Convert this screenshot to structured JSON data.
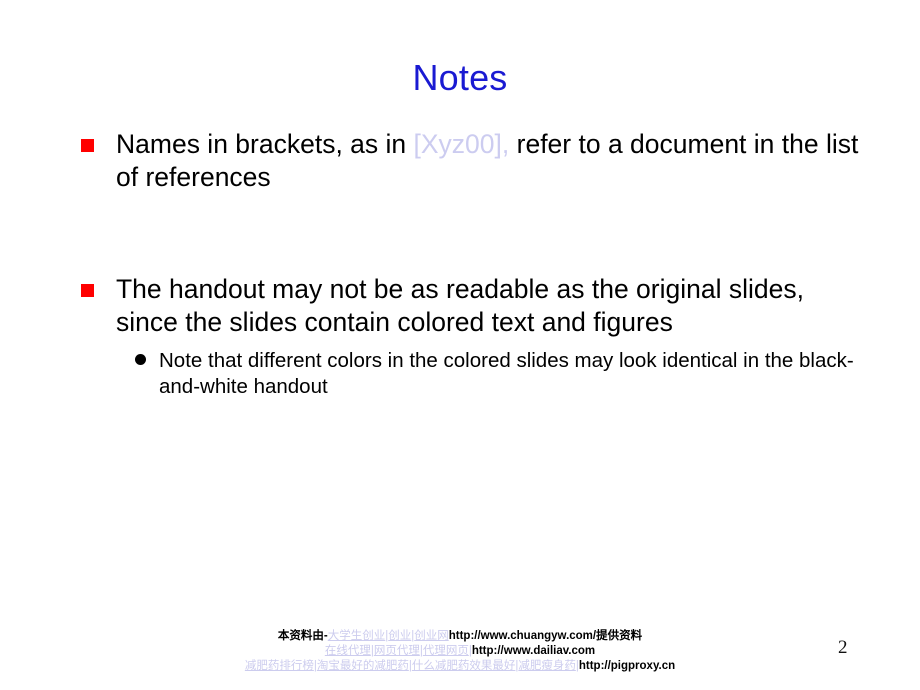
{
  "slide": {
    "title": "Notes",
    "title_color": "#1a1ad2",
    "bullet_marker_color": "#ff0000",
    "highlight_color": "#ccccf0",
    "page_number": "2"
  },
  "bullets": [
    {
      "marker": "red-square",
      "text_before": "Names in brackets, as in ",
      "highlight": "[Xyz00],",
      "text_after": " refer to a document in the list of references"
    },
    {
      "marker": "red-square",
      "text_before": "The handout may not be as readable as the original slides, since the slides contain colored text and figures",
      "highlight": "",
      "text_after": ""
    }
  ],
  "sub_bullets": [
    {
      "marker": "black-dot",
      "text": "Note that different colors in the colored slides may look identical in the black-and-white handout"
    }
  ],
  "footer": {
    "line1": {
      "prefix": "本资料由-",
      "links": [
        "大学生创业",
        "创业",
        "创业网"
      ],
      "url": "http://www.chuangyw.com/",
      "suffix": "提供资料"
    },
    "line2": {
      "prefix": "",
      "links": [
        "在线代理",
        "网页代理",
        "代理网页"
      ],
      "url": "http://www.dailiav.com",
      "suffix": ""
    },
    "line3": {
      "prefix": "",
      "links": [
        "减肥药排行榜",
        "淘宝最好的减肥药",
        "什么减肥药效果最好",
        "减肥瘦身药"
      ],
      "url": "http://pigproxy.cn",
      "suffix": ""
    },
    "separator": "|"
  }
}
